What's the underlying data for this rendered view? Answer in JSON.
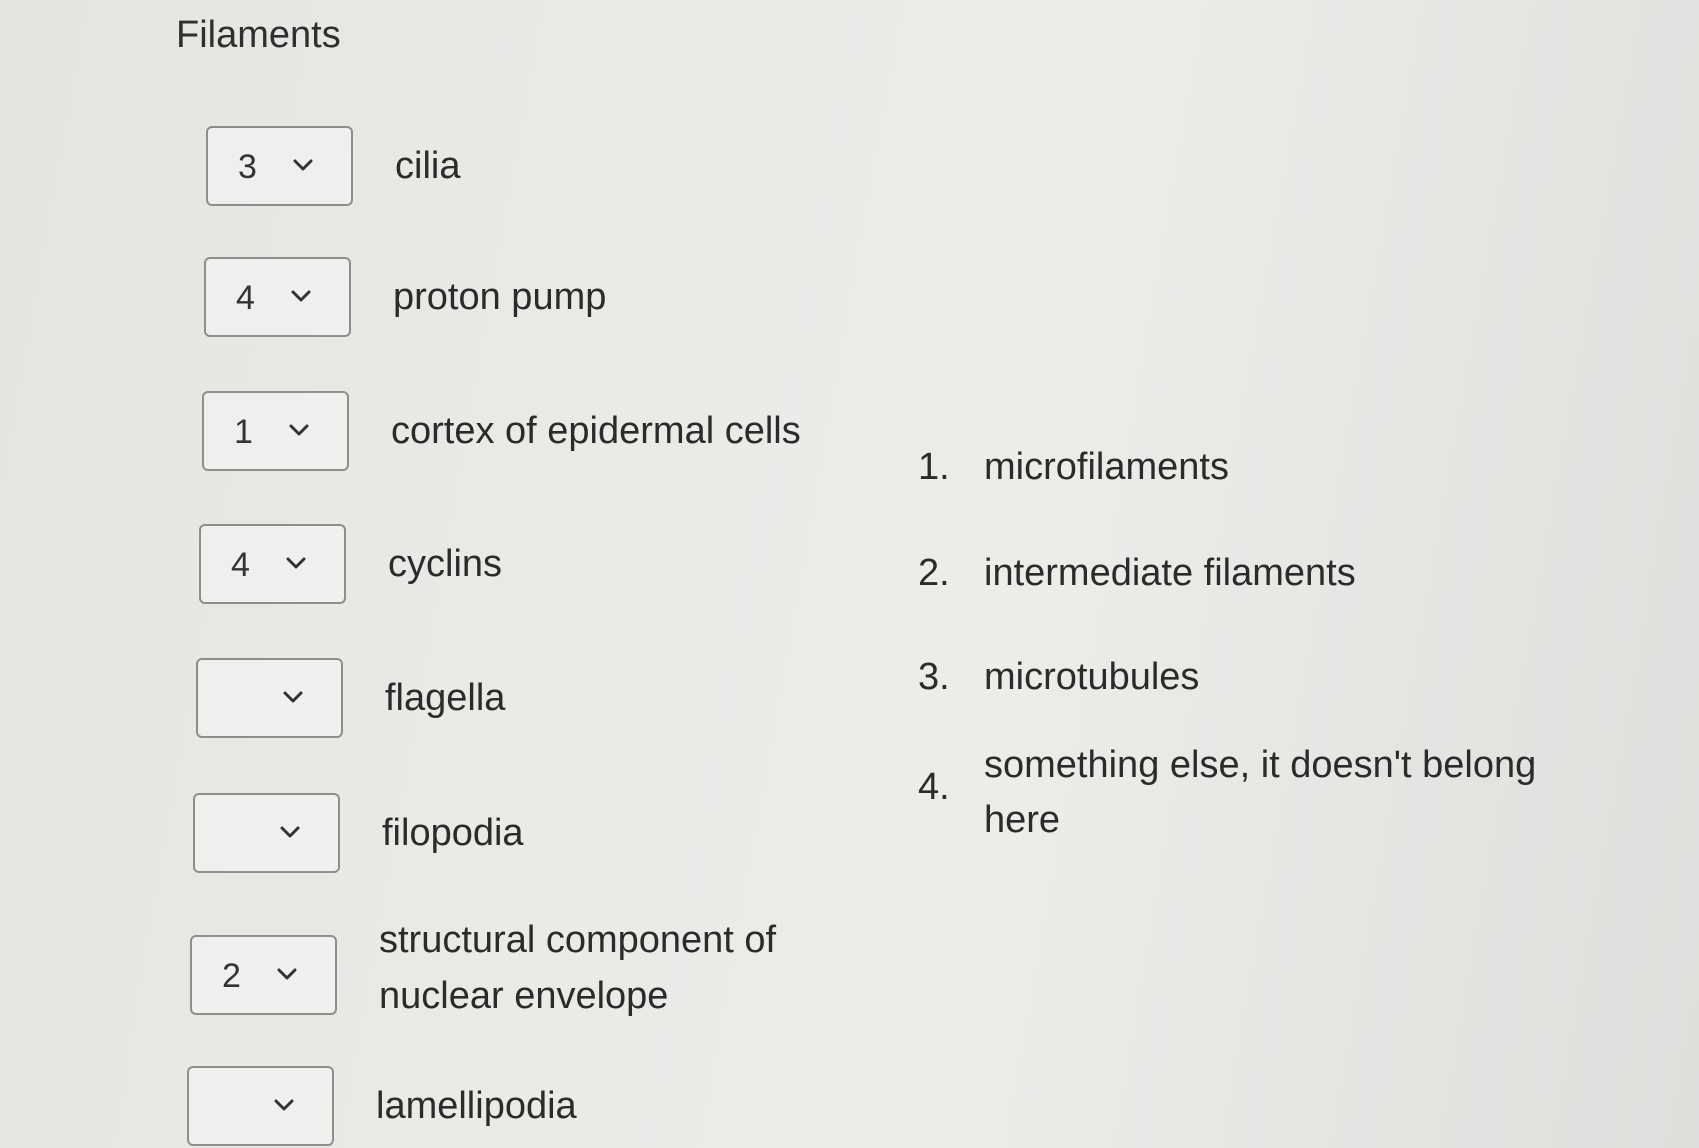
{
  "title": "Filaments",
  "items": [
    {
      "value": "3",
      "label": "cilia"
    },
    {
      "value": "4",
      "label": "proton pump"
    },
    {
      "value": "1",
      "label": "cortex of epidermal cells"
    },
    {
      "value": "4",
      "label": "cyclins"
    },
    {
      "value": "",
      "label": "flagella"
    },
    {
      "value": "",
      "label": "filopodia"
    },
    {
      "value": "2",
      "label": "structural component of nuclear envelope"
    },
    {
      "value": "",
      "label": "lamellipodia"
    }
  ],
  "options": [
    {
      "num": "1.",
      "text": "microfilaments"
    },
    {
      "num": "2.",
      "text": "intermediate filaments"
    },
    {
      "num": "3.",
      "text": "microtubules"
    },
    {
      "num": "4.",
      "text": "something else, it doesn't belong here"
    }
  ],
  "icons": {
    "dropdown": "chevron-down-icon"
  }
}
